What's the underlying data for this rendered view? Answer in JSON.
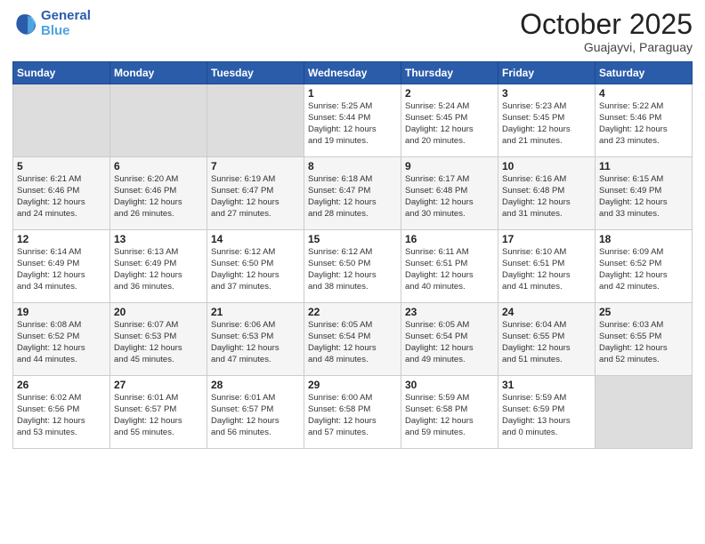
{
  "header": {
    "logo_line1": "General",
    "logo_line2": "Blue",
    "month": "October 2025",
    "location": "Guajayvi, Paraguay"
  },
  "weekdays": [
    "Sunday",
    "Monday",
    "Tuesday",
    "Wednesday",
    "Thursday",
    "Friday",
    "Saturday"
  ],
  "weeks": [
    [
      {
        "day": "",
        "info": ""
      },
      {
        "day": "",
        "info": ""
      },
      {
        "day": "",
        "info": ""
      },
      {
        "day": "1",
        "info": "Sunrise: 5:25 AM\nSunset: 5:44 PM\nDaylight: 12 hours\nand 19 minutes."
      },
      {
        "day": "2",
        "info": "Sunrise: 5:24 AM\nSunset: 5:45 PM\nDaylight: 12 hours\nand 20 minutes."
      },
      {
        "day": "3",
        "info": "Sunrise: 5:23 AM\nSunset: 5:45 PM\nDaylight: 12 hours\nand 21 minutes."
      },
      {
        "day": "4",
        "info": "Sunrise: 5:22 AM\nSunset: 5:46 PM\nDaylight: 12 hours\nand 23 minutes."
      }
    ],
    [
      {
        "day": "5",
        "info": "Sunrise: 6:21 AM\nSunset: 6:46 PM\nDaylight: 12 hours\nand 24 minutes."
      },
      {
        "day": "6",
        "info": "Sunrise: 6:20 AM\nSunset: 6:46 PM\nDaylight: 12 hours\nand 26 minutes."
      },
      {
        "day": "7",
        "info": "Sunrise: 6:19 AM\nSunset: 6:47 PM\nDaylight: 12 hours\nand 27 minutes."
      },
      {
        "day": "8",
        "info": "Sunrise: 6:18 AM\nSunset: 6:47 PM\nDaylight: 12 hours\nand 28 minutes."
      },
      {
        "day": "9",
        "info": "Sunrise: 6:17 AM\nSunset: 6:48 PM\nDaylight: 12 hours\nand 30 minutes."
      },
      {
        "day": "10",
        "info": "Sunrise: 6:16 AM\nSunset: 6:48 PM\nDaylight: 12 hours\nand 31 minutes."
      },
      {
        "day": "11",
        "info": "Sunrise: 6:15 AM\nSunset: 6:49 PM\nDaylight: 12 hours\nand 33 minutes."
      }
    ],
    [
      {
        "day": "12",
        "info": "Sunrise: 6:14 AM\nSunset: 6:49 PM\nDaylight: 12 hours\nand 34 minutes."
      },
      {
        "day": "13",
        "info": "Sunrise: 6:13 AM\nSunset: 6:49 PM\nDaylight: 12 hours\nand 36 minutes."
      },
      {
        "day": "14",
        "info": "Sunrise: 6:12 AM\nSunset: 6:50 PM\nDaylight: 12 hours\nand 37 minutes."
      },
      {
        "day": "15",
        "info": "Sunrise: 6:12 AM\nSunset: 6:50 PM\nDaylight: 12 hours\nand 38 minutes."
      },
      {
        "day": "16",
        "info": "Sunrise: 6:11 AM\nSunset: 6:51 PM\nDaylight: 12 hours\nand 40 minutes."
      },
      {
        "day": "17",
        "info": "Sunrise: 6:10 AM\nSunset: 6:51 PM\nDaylight: 12 hours\nand 41 minutes."
      },
      {
        "day": "18",
        "info": "Sunrise: 6:09 AM\nSunset: 6:52 PM\nDaylight: 12 hours\nand 42 minutes."
      }
    ],
    [
      {
        "day": "19",
        "info": "Sunrise: 6:08 AM\nSunset: 6:52 PM\nDaylight: 12 hours\nand 44 minutes."
      },
      {
        "day": "20",
        "info": "Sunrise: 6:07 AM\nSunset: 6:53 PM\nDaylight: 12 hours\nand 45 minutes."
      },
      {
        "day": "21",
        "info": "Sunrise: 6:06 AM\nSunset: 6:53 PM\nDaylight: 12 hours\nand 47 minutes."
      },
      {
        "day": "22",
        "info": "Sunrise: 6:05 AM\nSunset: 6:54 PM\nDaylight: 12 hours\nand 48 minutes."
      },
      {
        "day": "23",
        "info": "Sunrise: 6:05 AM\nSunset: 6:54 PM\nDaylight: 12 hours\nand 49 minutes."
      },
      {
        "day": "24",
        "info": "Sunrise: 6:04 AM\nSunset: 6:55 PM\nDaylight: 12 hours\nand 51 minutes."
      },
      {
        "day": "25",
        "info": "Sunrise: 6:03 AM\nSunset: 6:55 PM\nDaylight: 12 hours\nand 52 minutes."
      }
    ],
    [
      {
        "day": "26",
        "info": "Sunrise: 6:02 AM\nSunset: 6:56 PM\nDaylight: 12 hours\nand 53 minutes."
      },
      {
        "day": "27",
        "info": "Sunrise: 6:01 AM\nSunset: 6:57 PM\nDaylight: 12 hours\nand 55 minutes."
      },
      {
        "day": "28",
        "info": "Sunrise: 6:01 AM\nSunset: 6:57 PM\nDaylight: 12 hours\nand 56 minutes."
      },
      {
        "day": "29",
        "info": "Sunrise: 6:00 AM\nSunset: 6:58 PM\nDaylight: 12 hours\nand 57 minutes."
      },
      {
        "day": "30",
        "info": "Sunrise: 5:59 AM\nSunset: 6:58 PM\nDaylight: 12 hours\nand 59 minutes."
      },
      {
        "day": "31",
        "info": "Sunrise: 5:59 AM\nSunset: 6:59 PM\nDaylight: 13 hours\nand 0 minutes."
      },
      {
        "day": "",
        "info": ""
      }
    ]
  ]
}
